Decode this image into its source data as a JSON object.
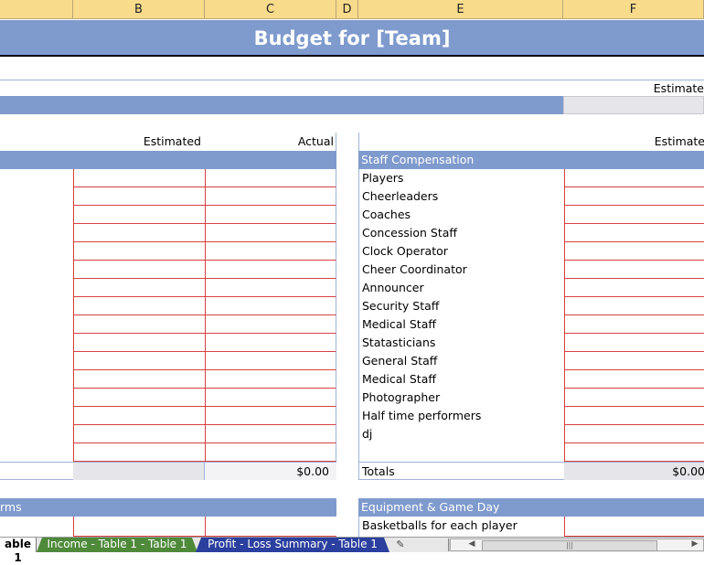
{
  "columns": [
    "",
    "B",
    "C",
    "D",
    "E",
    "F"
  ],
  "title": "Budget for [Team]",
  "summary_header": {
    "estimated": "Estimate"
  },
  "left_table": {
    "estimated_label": "Estimated",
    "actual_label": "Actual",
    "total_actual": "$0.00",
    "next_section": "rms"
  },
  "right_table": {
    "estimated_label": "Estimate",
    "section_title": "Staff Compensation",
    "items": [
      "Players",
      "Cheerleaders",
      "Coaches",
      "Concession Staff",
      "Clock Operator",
      "Cheer Coordinator",
      "Announcer",
      "Security Staff",
      "Medical Staff",
      "Statasticians",
      "General Staff",
      "Medical Staff",
      "Photographer",
      "Half time performers",
      "dj"
    ],
    "totals_label": "Totals",
    "totals_value": "$0.00",
    "next_section": "Equipment & Game Day",
    "next_item": "Basketballs for each player"
  },
  "sheet_tabs": {
    "active": "able 1",
    "tab1": "Income - Table 1 - Table 1",
    "tab2": "Profit - Loss Summary - Table 1",
    "new_sheet": "✎",
    "scroll_left": "◀",
    "scroll_right": "▶",
    "grip": "|||"
  }
}
